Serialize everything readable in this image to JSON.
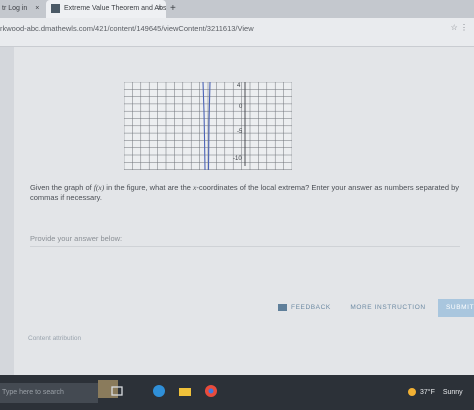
{
  "browser": {
    "prev_tab_label": "tr Log in",
    "prev_tab_close": "×",
    "active_tab_title": "Extreme Value Theorem and Abs",
    "active_tab_close": "×",
    "new_tab": "+",
    "url": "rkwood-abc.dmathewls.com/421/content/149645/viewContent/3211613/View",
    "address_icons": "☆  ⋮"
  },
  "graph": {
    "tick_labels": [
      "4",
      "0",
      "-5",
      "-10"
    ]
  },
  "question": {
    "text_before": "Given the graph of ",
    "function_name": "f(x)",
    "text_middle": " in the figure, what are the ",
    "var_name": "x",
    "text_after": "-coordinates of the local extrema? Enter your answer as numbers separated by commas if necessary.",
    "prompt": "Provide your answer below:"
  },
  "actions": {
    "feedback": "FEEDBACK",
    "more_instruction": "MORE INSTRUCTION",
    "submit": "SUBMIT"
  },
  "footer": {
    "contact": "Content attribution"
  },
  "taskbar": {
    "search": "Type here to search",
    "temperature": "37°F",
    "condition": "Sunny"
  },
  "colors": {
    "curve": "#4a62b5",
    "grid": "#6f7379",
    "accent": "#6d8aa3"
  }
}
